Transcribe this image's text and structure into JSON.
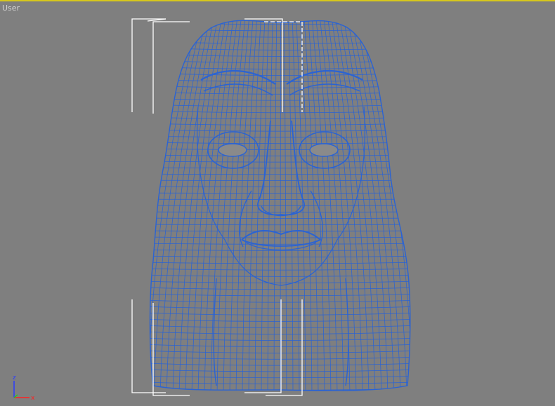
{
  "viewport": {
    "label": "User",
    "border_color": "#d8c81c",
    "background": "#7f7f7f",
    "wire_color": "#2a63d4",
    "bracket_color": "#ffffff"
  },
  "axis_tripod": {
    "z_label": "z",
    "x_label": "x",
    "z_color": "#2a3cff",
    "x_color": "#ff2020",
    "y_color": "#22cc22"
  }
}
